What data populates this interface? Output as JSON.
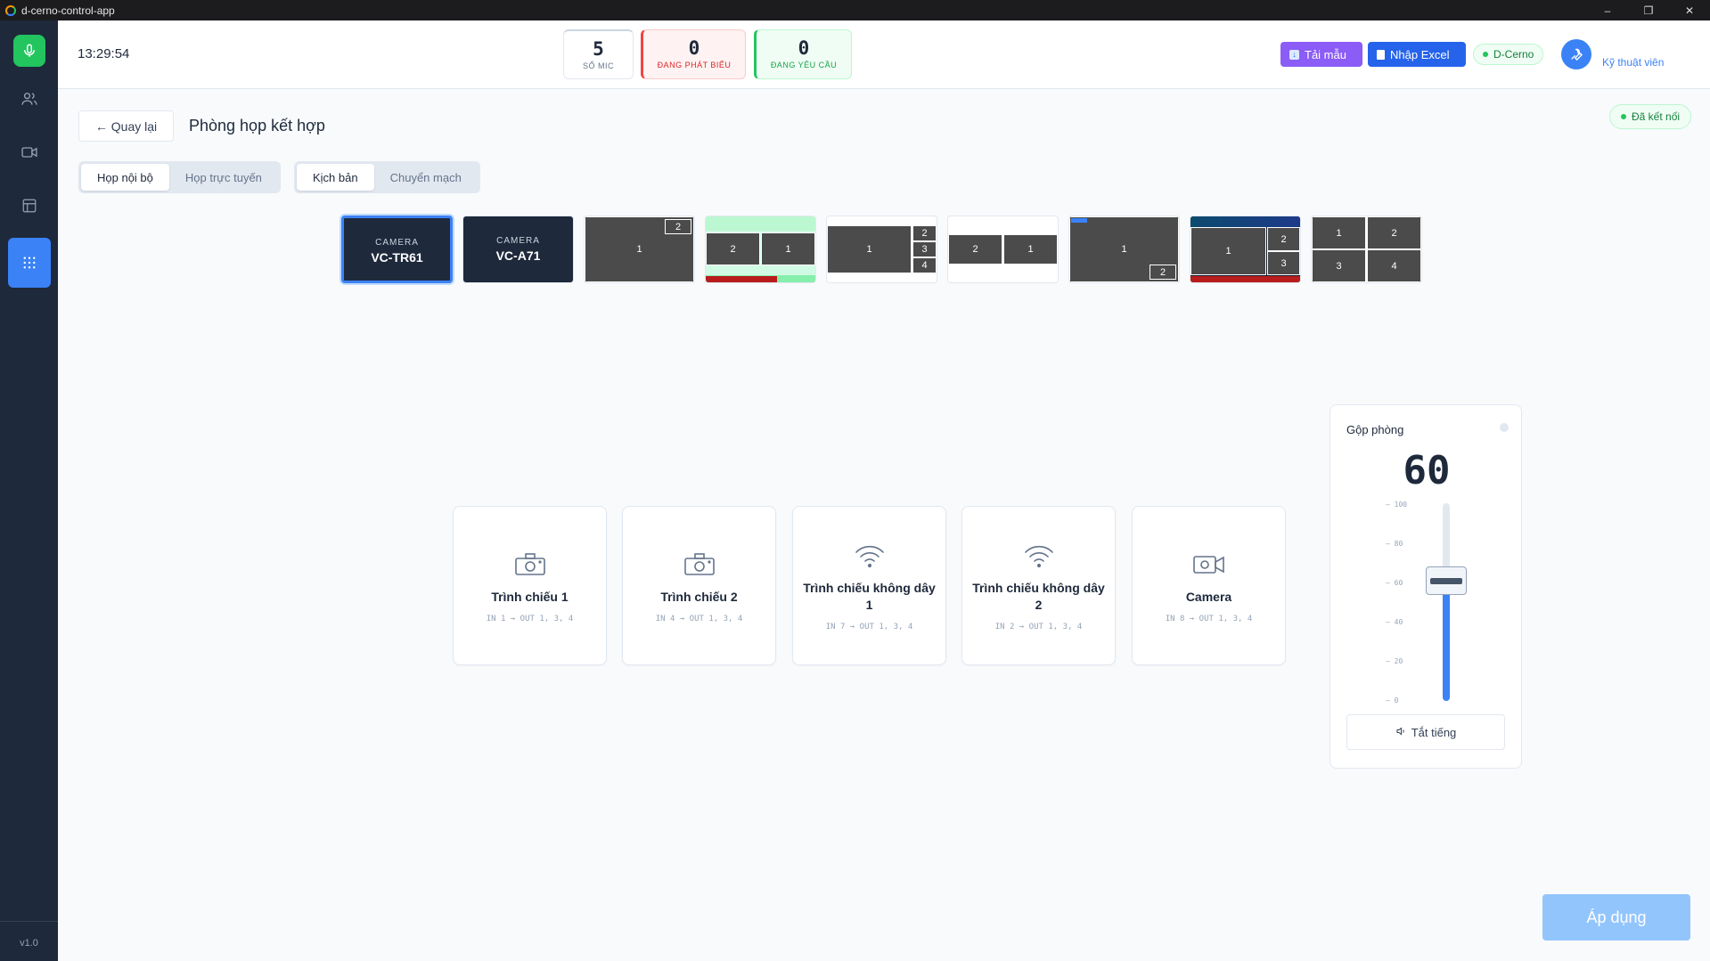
{
  "window": {
    "title": "d-cerno-control-app",
    "controls": [
      "–",
      "❐",
      "✕"
    ]
  },
  "sidebar": {
    "version": "v1.0",
    "items": [
      "people-icon",
      "video-icon",
      "layout-icon",
      "grid-icon"
    ],
    "active_item": "grid-icon"
  },
  "header": {
    "clock": "13:29:54",
    "stats": [
      {
        "num": "5",
        "label": "SỐ MIC"
      },
      {
        "num": "0",
        "label": "ĐANG PHÁT BIỂU"
      },
      {
        "num": "0",
        "label": "ĐANG YÊU CẦU"
      }
    ],
    "download_label": "Tải mẫu",
    "excel_label": "Nhập Excel",
    "device_label": "D-Cerno",
    "role_label": "Kỹ thuật viên",
    "colors": {
      "download": "#8b5cf6",
      "excel": "#2563eb",
      "status": "#22c55e"
    }
  },
  "main": {
    "back_label": "← Quay lại",
    "title": "Phòng họp kết hợp",
    "connection_label": "Đã kết nối",
    "meeting_tabs": [
      "Họp nội bộ",
      "Họp trực tuyến"
    ],
    "meeting_tab_active": "Họp nội bộ",
    "mode_tabs": [
      "Kịch bản",
      "Chuyển mạch"
    ],
    "mode_tab_active": "Kịch bản",
    "cameras": [
      {
        "caption": "CAMERA",
        "name": "VC-TR61",
        "selected": true
      },
      {
        "caption": "CAMERA",
        "name": "VC-A71",
        "selected": false
      }
    ],
    "layouts": [
      {
        "labels": [
          "1",
          "2"
        ]
      },
      {
        "labels": [
          "2",
          "1"
        ]
      },
      {
        "labels": [
          "1",
          "2",
          "3",
          "4"
        ]
      },
      {
        "labels": [
          "2",
          "1"
        ]
      },
      {
        "labels": [
          "1",
          "2"
        ]
      },
      {
        "labels": [
          "1",
          "2",
          "3"
        ]
      },
      {
        "labels": [
          "1",
          "2",
          "3",
          "4"
        ]
      }
    ],
    "sources": [
      {
        "name": "Trình chiếu 1",
        "route": "IN 1 → OUT 1, 3, 4",
        "icon": "projector-icon"
      },
      {
        "name": "Trình chiếu 2",
        "route": "IN 4 → OUT 1, 3, 4",
        "icon": "projector-icon"
      },
      {
        "name": "Trình chiếu không dây 1",
        "route": "IN 7 → OUT 1, 3, 4",
        "icon": "wifi-icon"
      },
      {
        "name": "Trình chiếu không dây 2",
        "route": "IN 2 → OUT 1, 3, 4",
        "icon": "wifi-icon"
      },
      {
        "name": "Camera",
        "route": "IN 8 → OUT 1, 3, 4",
        "icon": "video-camera-icon"
      }
    ],
    "volume": {
      "title": "Gộp phòng",
      "value": 60,
      "display": "60",
      "ticks": [
        "100",
        "80",
        "60",
        "40",
        "20",
        "0"
      ],
      "mute_label": "Tắt tiếng"
    },
    "apply_label": "Áp dụng"
  }
}
